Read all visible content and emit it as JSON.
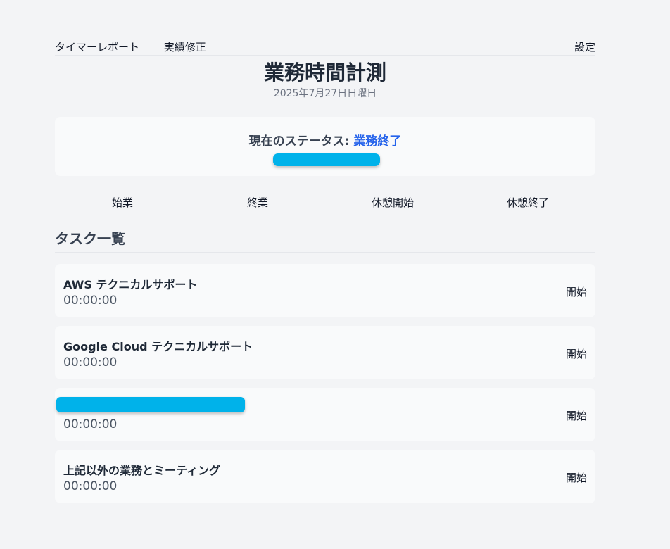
{
  "nav": {
    "timer_report": "タイマーレポート",
    "edit_records": "実績修正",
    "settings": "設定"
  },
  "header": {
    "title": "業務時間計測",
    "date": "2025年7月27日日曜日"
  },
  "status": {
    "label": "現在のステータス: ",
    "value": "業務終了",
    "value_color": "#2563eb",
    "redaction_color": "#00b2ea"
  },
  "actions": {
    "start_work": "始業",
    "end_work": "終業",
    "break_start": "休憩開始",
    "break_end": "休憩終了"
  },
  "tasks_section": {
    "title": "タスク一覧",
    "start_label": "開始",
    "items": [
      {
        "name": "AWS テクニカルサポート",
        "time": "00:00:00"
      },
      {
        "name": "Google Cloud テクニカルサポート",
        "time": "00:00:00"
      },
      {
        "name": "",
        "time": "00:00:00"
      },
      {
        "name": "上記以外の業務とミーティング",
        "time": "00:00:00"
      }
    ]
  }
}
